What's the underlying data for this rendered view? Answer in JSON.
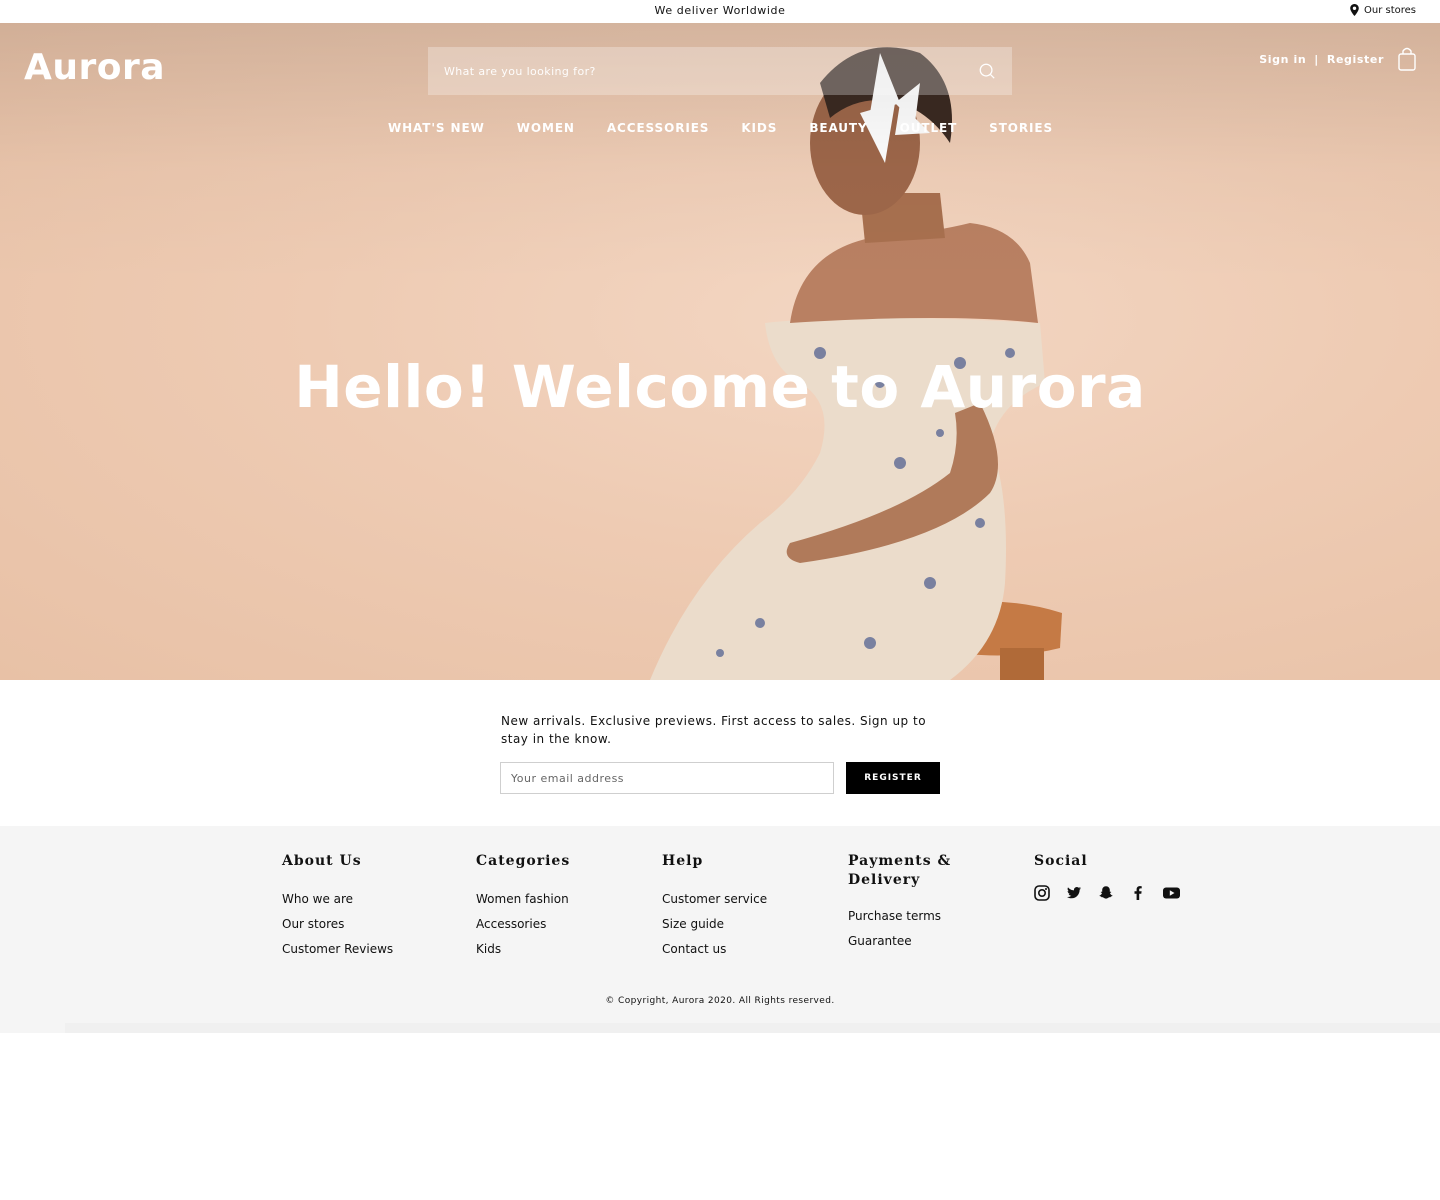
{
  "topbar": {
    "announcement": "We deliver Worldwide",
    "stores_label": "Our stores"
  },
  "header": {
    "logo": "Aurora",
    "search_placeholder": "What are you looking for?",
    "sign_in": "Sign in",
    "separator": "|",
    "register": "Register"
  },
  "nav": {
    "items": [
      "WHAT'S NEW",
      "WOMEN",
      "ACCESSORIES",
      "KIDS",
      "BEAUTY",
      "OUTLET",
      "STORIES"
    ]
  },
  "hero": {
    "title": "Hello! Welcome to Aurora"
  },
  "newsletter": {
    "message": "New arrivals. Exclusive previews. First access to sales. Sign up to stay in the know.",
    "email_placeholder": "Your email address",
    "button": "REGISTER"
  },
  "footer": {
    "columns": [
      {
        "title": "About Us",
        "links": [
          "Who we are",
          "Our stores",
          "Customer Reviews"
        ]
      },
      {
        "title": "Categories",
        "links": [
          "Women fashion",
          "Accessories",
          "Kids"
        ]
      },
      {
        "title": "Help",
        "links": [
          "Customer service",
          "Size guide",
          "Contact us"
        ]
      },
      {
        "title": "Payments & Delivery",
        "links": [
          "Purchase terms",
          "Guarantee"
        ]
      },
      {
        "title": "Social",
        "icons": [
          "instagram-icon",
          "twitter-icon",
          "snapchat-icon",
          "facebook-icon",
          "youtube-icon"
        ]
      }
    ],
    "copyright": "© Copyright, Aurora 2020. All Rights reserved."
  },
  "colors": {
    "hero_bg": "#eecbb3",
    "button_bg": "#000000",
    "footer_bg": "#f5f5f5"
  }
}
